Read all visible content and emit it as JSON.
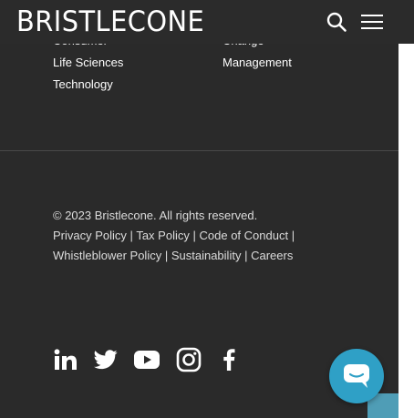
{
  "header": {
    "logo_text": "BRISTLECONE",
    "search_label": "search",
    "menu_label": "Menu"
  },
  "footer_links": {
    "col1": [
      "Consumer",
      "Life Sciences",
      "Technology"
    ],
    "col2": [
      "Change",
      "Management"
    ]
  },
  "legal": {
    "copyright": "© 2023 Bristlecone. All rights reserved.",
    "privacy": "Privacy Policy",
    "tax": "Tax Policy",
    "conduct": "Code of Conduct",
    "whistle": "Whistleblower Policy",
    "sustain": "Sustainability",
    "careers": "Careers",
    "separator": "|"
  },
  "social": [
    "linkedin-icon",
    "twitter-icon",
    "youtube-icon",
    "instagram-icon",
    "facebook-icon"
  ],
  "colors": {
    "background": "#2a2a2a",
    "text": "#ffffff",
    "chat_accent": "#2fa0c6"
  }
}
